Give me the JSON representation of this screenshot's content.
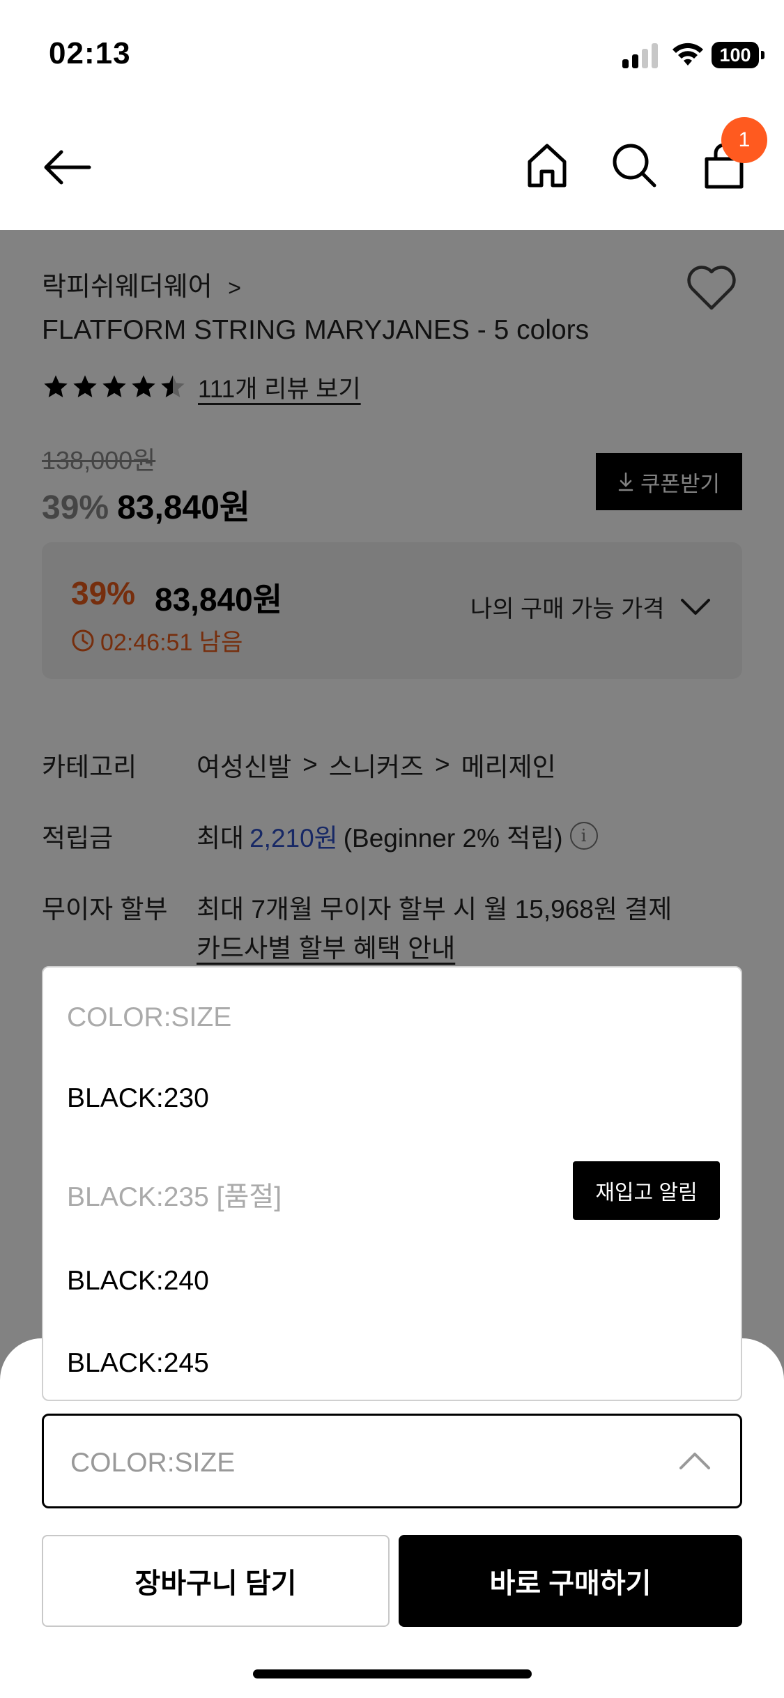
{
  "status_bar": {
    "time": "02:13",
    "battery": "100"
  },
  "header": {
    "cart_count": "1"
  },
  "product": {
    "brand": "락피쉬웨더웨어",
    "brand_chevron": ">",
    "name": "FLATFORM STRING MARYJANES - 5 colors",
    "rating": 4.5,
    "review_link": "111개 리뷰 보기",
    "original_price": "138,000원",
    "discount": "39%",
    "sale_price": "83,840원",
    "coupon_label": "쿠폰받기"
  },
  "price_box": {
    "discount": "39%",
    "price": "83,840원",
    "timer": "02:46:51 남음",
    "my_price_label": "나의 구매 가능 가격"
  },
  "info": {
    "category_label": "카테고리",
    "category_path": [
      "여성신발",
      "스니커즈",
      "메리제인"
    ],
    "category_sep": ">",
    "points_label": "적립금",
    "points_prefix": "최대",
    "points_value": "2,210원",
    "points_suffix": "(Beginner 2% 적립)",
    "points_info_icon": "i",
    "installment_label": "무이자 할부",
    "installment_text": "최대 7개월 무이자 할부 시 월 15,968원 결제",
    "card_link": "카드사별 할부 혜택 안내"
  },
  "dropdown": {
    "items": [
      {
        "label": "COLOR:SIZE",
        "state": "placeholder"
      },
      {
        "label": "BLACK:230",
        "state": "available"
      },
      {
        "label": "BLACK:235 [품절]",
        "state": "soldout"
      },
      {
        "label": "BLACK:240",
        "state": "available"
      },
      {
        "label": "BLACK:245",
        "state": "available"
      }
    ],
    "restock_label": "재입고 알림"
  },
  "select": {
    "value": "COLOR:SIZE"
  },
  "actions": {
    "cart_label": "장바구니 담기",
    "buy_label": "바로 구매하기"
  },
  "colors": {
    "accent_orange": "#e85a1a",
    "badge": "#ff5a1f",
    "points_blue": "#2d4fc7"
  }
}
